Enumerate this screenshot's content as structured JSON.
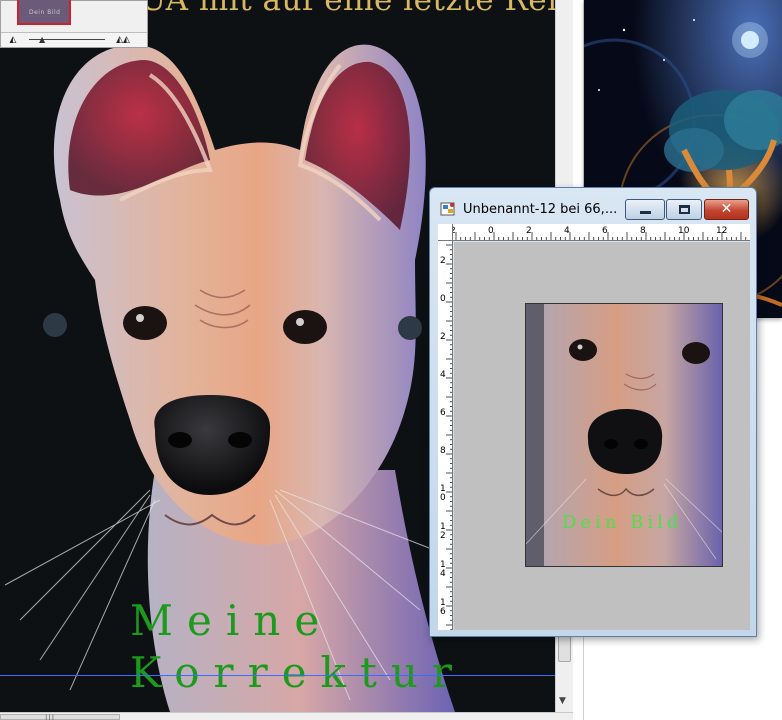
{
  "main_document": {
    "headline": "UA mit auf eine letzte Reise",
    "korrektur_line1": "Meine",
    "korrektur_line2": "Korrektur"
  },
  "navigator": {
    "thumbnail_caption": "Dein Bild",
    "zoom_out_icon": "zoom-out-mountain-icon",
    "zoom_in_icon": "zoom-in-mountain-icon"
  },
  "doc_window": {
    "title": "Unbenannt-12 bei 66,...",
    "app_icon": "psp-document-icon",
    "caption": "Dein Bild",
    "buttons": {
      "minimize": "minimize-icon",
      "maximize": "maximize-icon",
      "close": "close-icon"
    },
    "ruler_top_labels": [
      "2",
      "0",
      "2",
      "4",
      "6",
      "8",
      "10",
      "12"
    ],
    "ruler_left_labels": [
      "2",
      "0",
      "2",
      "4",
      "6",
      "8",
      "10",
      "12",
      "14",
      "16"
    ]
  },
  "colors": {
    "headline": "#d9b860",
    "korrektur": "#1d9a1d",
    "caption": "#4ce04c",
    "guide_line": "#3d6bff",
    "close_button": "#c2462f"
  }
}
